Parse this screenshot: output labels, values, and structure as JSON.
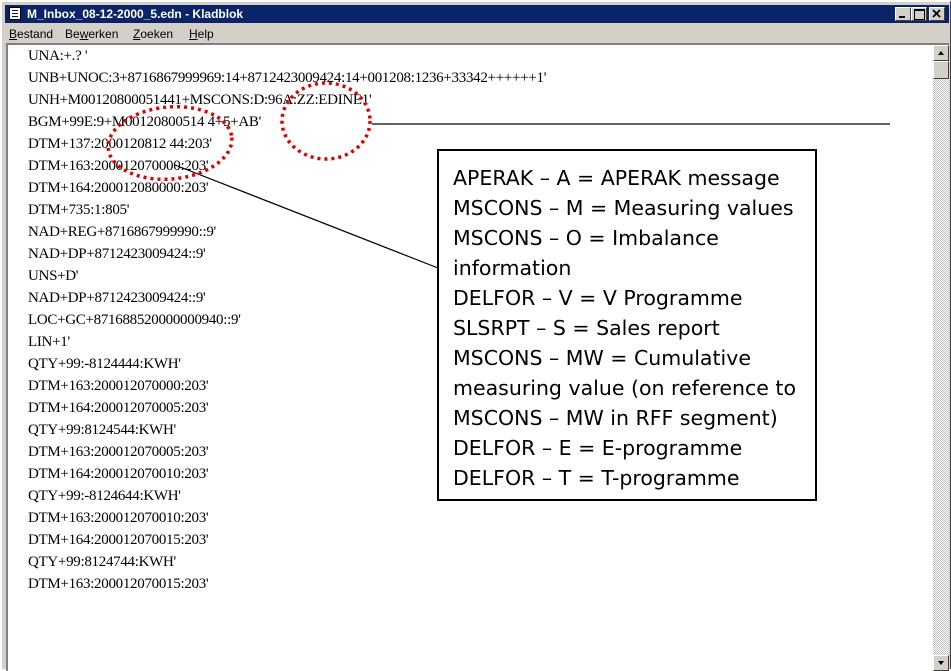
{
  "window": {
    "title": "M_Inbox_08-12-2000_5.edn - Kladblok"
  },
  "menu": [
    {
      "label": "Bestand",
      "accel": "B",
      "rest": "estand"
    },
    {
      "label": "Bewerken",
      "prefix": "Be",
      "accel": "w",
      "rest": "erken"
    },
    {
      "label": "Zoeken",
      "accel": "Z",
      "rest": "oeken"
    },
    {
      "label": "Help",
      "accel": "H",
      "rest": "elp"
    }
  ],
  "editor": {
    "lines": [
      "UNA:+.? '",
      "UNB+UNOC:3+8716867999969:14+8712423009424:14+001208:1236+33342++++++1'",
      "UNH+M00120800051441+MSCONS:D:96A:ZZ:EDINE1'",
      "BGM+99E:9+M00120800514 4+5+AB'",
      "DTM+137:2000120812 44:203'",
      "DTM+163:200012070000:203'",
      "DTM+164:200012080000:203'",
      "DTM+735:1:805'",
      "NAD+REG+8716867999990::9'",
      "NAD+DP+8712423009424::9'",
      "UNS+D'",
      "NAD+DP+8712423009424::9'",
      "LOC+GC+871688520000000940::9'",
      "LIN+1'",
      "QTY+99:-8124444:KWH'",
      "DTM+163:200012070000:203'",
      "DTM+164:200012070005:203'",
      "QTY+99:8124544:KWH'",
      "DTM+163:200012070005:203'",
      "DTM+164:200012070010:203'",
      "QTY+99:-8124644:KWH'",
      "DTM+163:200012070010:203'",
      "DTM+164:200012070015:203'",
      "QTY+99:8124744:KWH'",
      "DTM+163:200012070015:203'"
    ]
  },
  "legend": {
    "lines": [
      "APERAK – A = APERAK message",
      "MSCONS – M = Measuring values",
      "MSCONS – O = Imbalance",
      "information",
      "DELFOR – V = V Programme",
      "SLSRPT – S = Sales report",
      "MSCONS – MW = Cumulative",
      "measuring value (on reference to",
      "MSCONS – MW in RFF segment)",
      "DELFOR – E = E-programme",
      "DELFOR – T = T-programme"
    ]
  },
  "annotation_color": "#e00000",
  "icons": [
    "notepad-icon",
    "minimize-icon",
    "maximize-icon",
    "close-icon",
    "scroll-up-icon",
    "scroll-down-icon"
  ]
}
